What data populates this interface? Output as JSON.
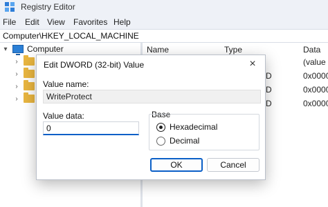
{
  "window": {
    "title": "Registry Editor"
  },
  "menu": [
    "File",
    "Edit",
    "View",
    "Favorites",
    "Help"
  ],
  "address": "Computer\\HKEY_LOCAL_MACHINE",
  "tree": {
    "root_label": "Computer"
  },
  "list": {
    "columns": [
      "Name",
      "Type",
      "Data"
    ],
    "rows": [
      {
        "type": "",
        "data": "(value n"
      },
      {
        "type": "D",
        "data": "0x0000"
      },
      {
        "type": "D",
        "data": "0x0000"
      },
      {
        "type": "D",
        "data": "0x0000"
      }
    ]
  },
  "dialog": {
    "title": "Edit DWORD (32-bit) Value",
    "value_name_label": "Value name:",
    "value_name": "WriteProtect",
    "value_data_label": "Value data:",
    "value_data": "0",
    "base_label": "Base",
    "base_options": [
      "Hexadecimal",
      "Decimal"
    ],
    "selected_base": "Hexadecimal",
    "ok_label": "OK",
    "cancel_label": "Cancel",
    "close_glyph": "×"
  },
  "colors": {
    "accent": "#0a5fc7",
    "folder": "#e9b640",
    "chrome": "#eef1f7"
  }
}
